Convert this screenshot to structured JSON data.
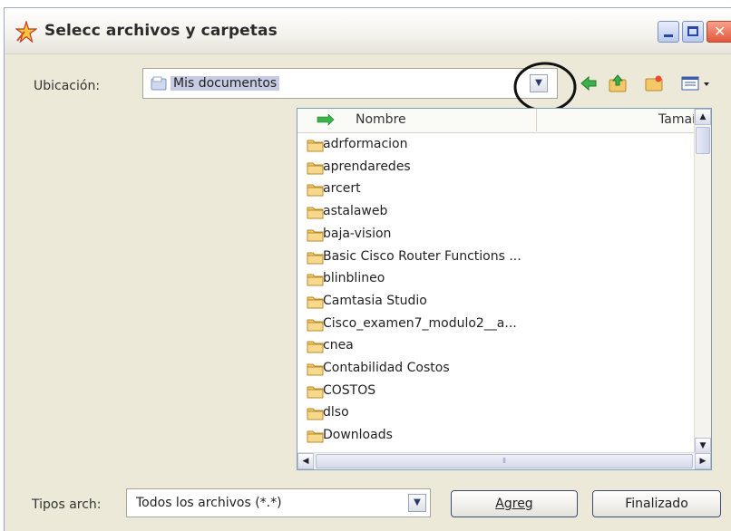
{
  "window": {
    "title": "Selecc archivos y carpetas"
  },
  "location": {
    "label": "Ubicación:",
    "value": "Mis documentos"
  },
  "toolbar": {
    "icons": [
      "back-arrow-icon",
      "up-folder-icon",
      "new-folder-icon",
      "views-menu-icon"
    ]
  },
  "list": {
    "columns": [
      "Nombre",
      "Tamaí"
    ],
    "items": [
      "adrformacion",
      "aprendaredes",
      "arcert",
      "astalaweb",
      "baja-vision",
      "Basic Cisco Router Functions ...",
      "blinblineo",
      "Camtasia Studio",
      "Cisco_examen7_modulo2__a...",
      "cnea",
      "Contabilidad Costos",
      "COSTOS",
      "dlso",
      "Downloads"
    ]
  },
  "file_type": {
    "label": "Tipos arch:",
    "value": "Todos los archivos (*.*)"
  },
  "buttons": {
    "add": "Agreg",
    "done": "Finalizado"
  },
  "colors": {
    "selection": "#c7cbe3",
    "window_bg": "#ece9d8",
    "close_button": "#e3573b",
    "folder": "#f2c86b"
  }
}
